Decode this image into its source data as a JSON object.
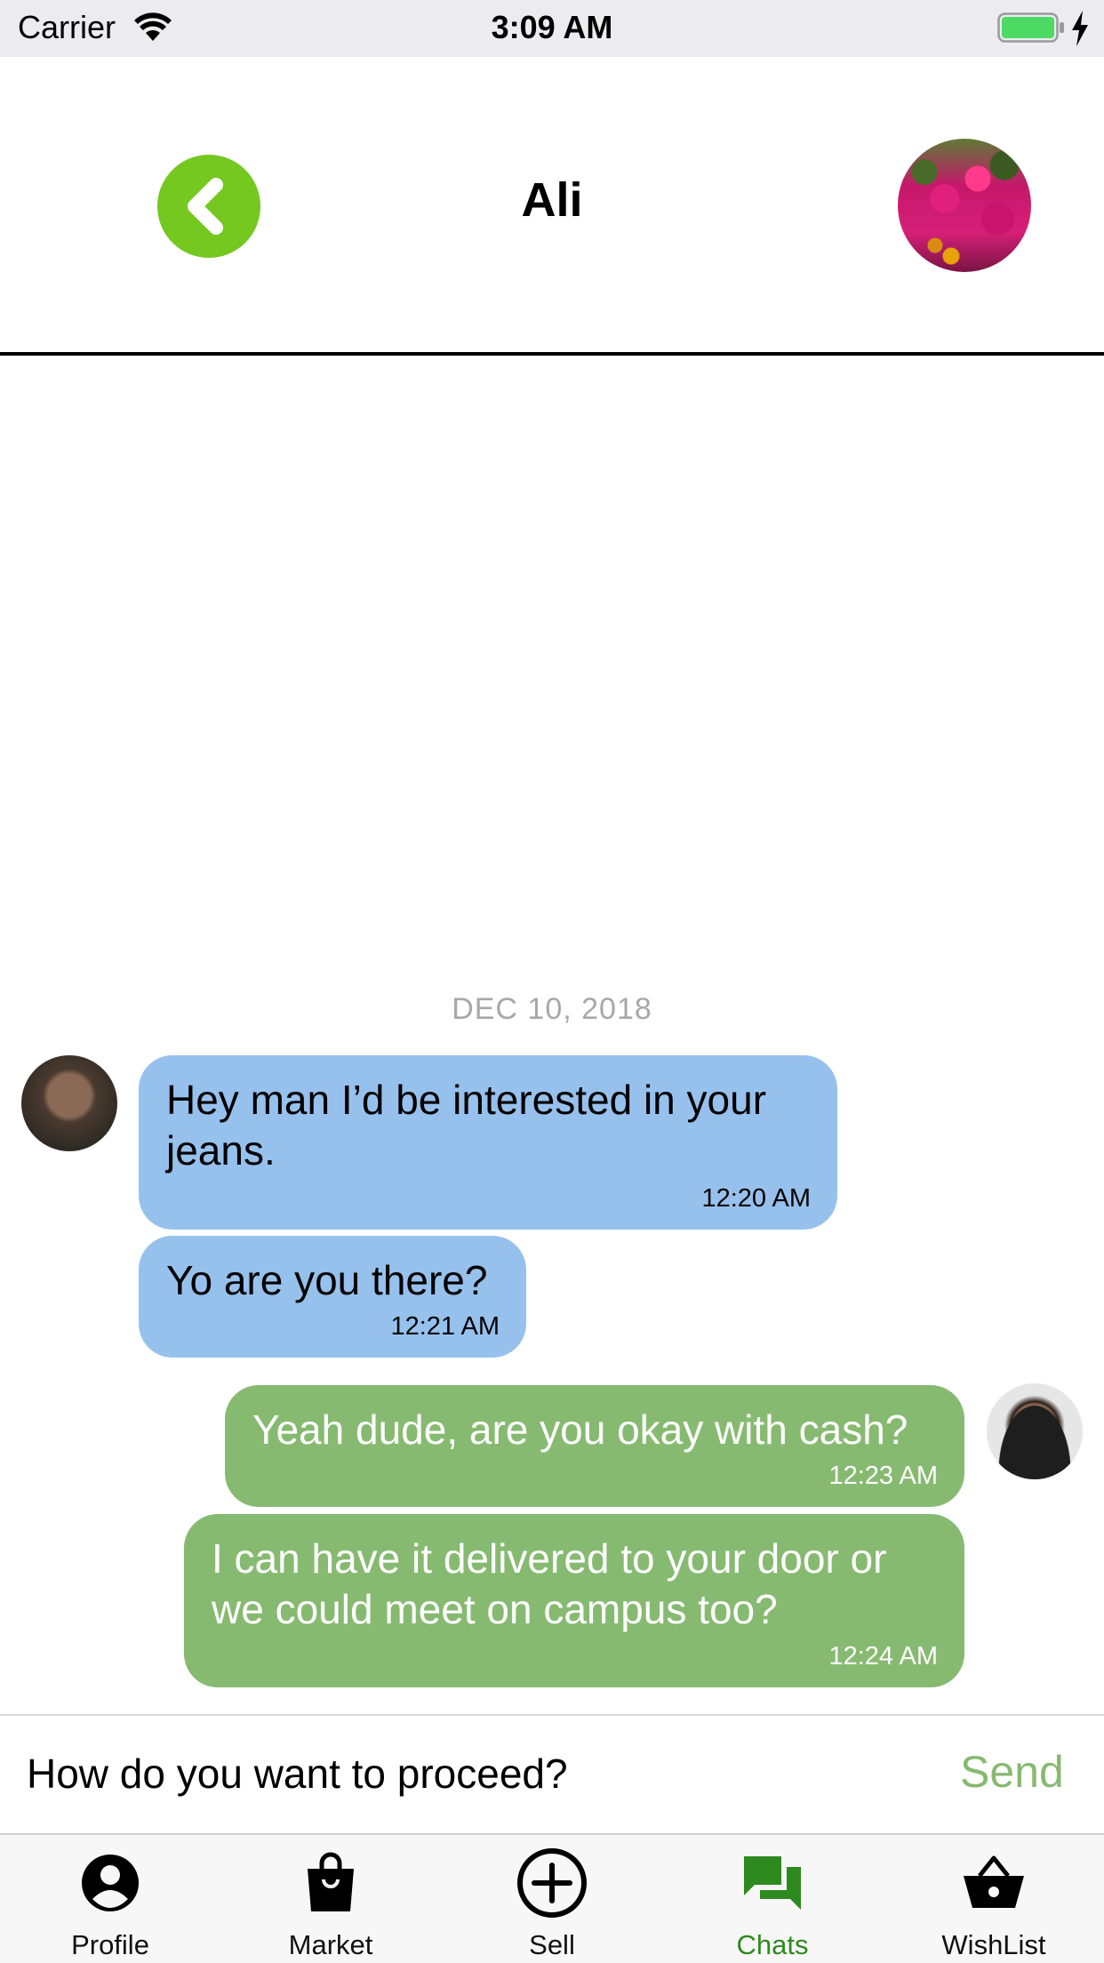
{
  "status_bar": {
    "carrier": "Carrier",
    "time": "3:09 AM",
    "battery_color": "#4cd964"
  },
  "header": {
    "title": "Ali",
    "back_color": "#74c820"
  },
  "conversation": {
    "date": "DEC 10, 2018",
    "messages": [
      {
        "direction": "incoming",
        "text": "Hey man I’d be interested in your jeans.",
        "time": "12:20 AM"
      },
      {
        "direction": "incoming",
        "text": "Yo are you there?",
        "time": "12:21 AM"
      },
      {
        "direction": "outgoing",
        "text": "Yeah dude, are you okay with cash?",
        "time": "12:23 AM"
      },
      {
        "direction": "outgoing",
        "text": "I can have it delivered to your door or we could meet on campus too?",
        "time": "12:24 AM"
      }
    ],
    "incoming_color": "#97c1ed",
    "outgoing_color": "#87ba71"
  },
  "composer": {
    "value": "How do you want to proceed?",
    "send_label": "Send"
  },
  "tabs": [
    {
      "label": "Profile",
      "icon": "profile-icon",
      "active": false
    },
    {
      "label": "Market",
      "icon": "shopping-bag-icon",
      "active": false
    },
    {
      "label": "Sell",
      "icon": "plus-circle-icon",
      "active": false
    },
    {
      "label": "Chats",
      "icon": "chat-bubbles-icon",
      "active": true
    },
    {
      "label": "WishList",
      "icon": "basket-icon",
      "active": false
    }
  ],
  "accent_color": "#2e8a1e"
}
